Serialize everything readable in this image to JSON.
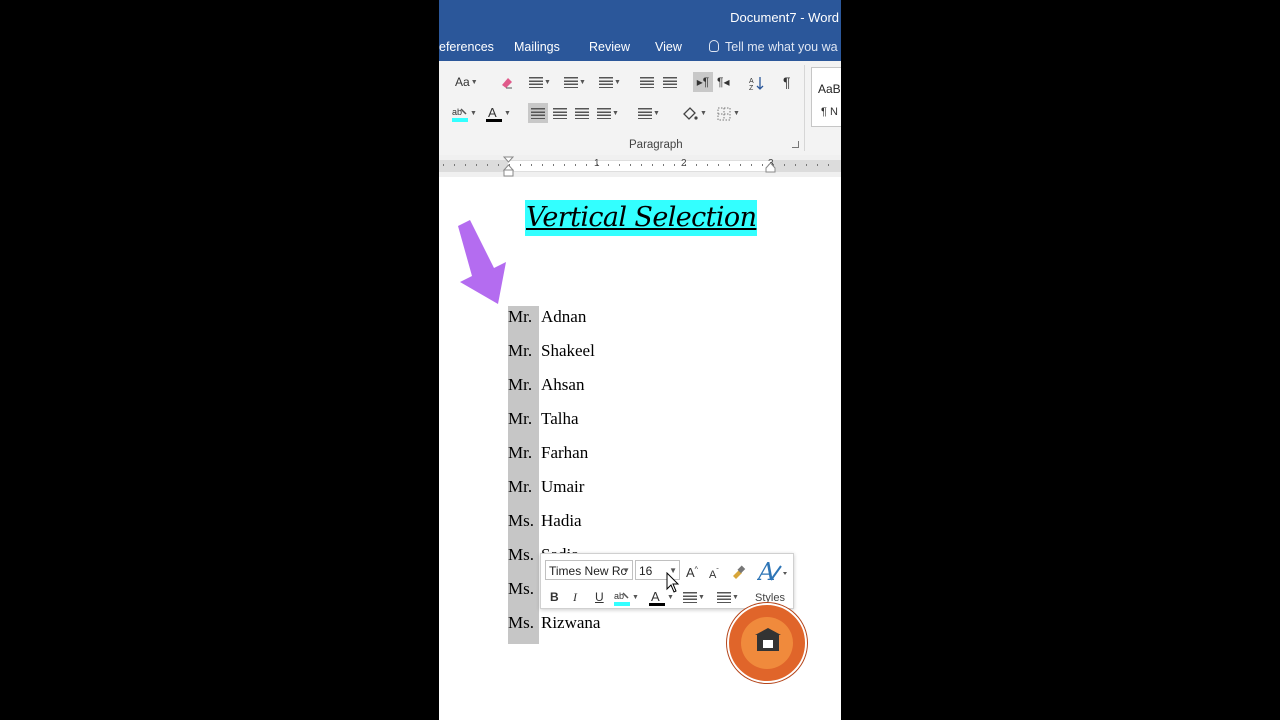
{
  "window": {
    "title": "Document7  -  Word"
  },
  "tabs": [
    {
      "label": "eferences"
    },
    {
      "label": "Mailings"
    },
    {
      "label": "Review"
    },
    {
      "label": "View"
    }
  ],
  "tell_me": {
    "text": "Tell me what you wa"
  },
  "ribbon": {
    "font_case_label": "Aa",
    "paragraph_group_label": "Paragraph",
    "pilcrow": "¶",
    "styles_preview": "AaB",
    "styles_normal": "¶ N"
  },
  "ruler": {
    "marks": [
      "1",
      "2",
      "3"
    ]
  },
  "document": {
    "title": "Vertical Selection",
    "names": [
      {
        "title": "Mr.",
        "name": "Adnan"
      },
      {
        "title": "Mr.",
        "name": "Shakeel"
      },
      {
        "title": "Mr.",
        "name": "Ahsan"
      },
      {
        "title": "Mr.",
        "name": "Talha"
      },
      {
        "title": "Mr.",
        "name": "Farhan"
      },
      {
        "title": "Mr.",
        "name": "Umair"
      },
      {
        "title": "Ms.",
        "name": "Hadia"
      },
      {
        "title": "Ms.",
        "name": "Sadia"
      },
      {
        "title": "Ms.",
        "name": ""
      },
      {
        "title": "Ms.",
        "name": "Rizwana"
      }
    ]
  },
  "mini_toolbar": {
    "font_name": "Times New Rc",
    "font_size": "16",
    "bold": "B",
    "italic": "I",
    "underline": "U",
    "styles_label": "Styles"
  },
  "colors": {
    "title_bar": "#2b579a",
    "highlight": "#33ffff",
    "selection": "#c6c6c6",
    "arrow": "#b46cf0"
  }
}
